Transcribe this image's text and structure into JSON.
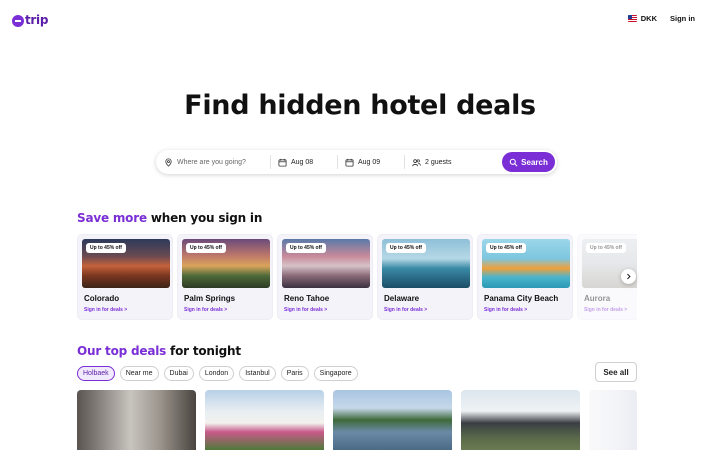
{
  "header": {
    "logo_text": "trip",
    "currency": "DKK",
    "sign_in": "Sign in",
    "flag_icon": "us-flag-icon"
  },
  "hero": {
    "title": "Find hidden hotel deals"
  },
  "search": {
    "destination_placeholder": "Where are you going?",
    "check_in": "Aug 08",
    "check_out": "Aug 09",
    "guests": "2 guests",
    "search_label": "Search",
    "accent_color": "#7a2ed6"
  },
  "deals_section": {
    "title_accent": "Save more",
    "title_rest": " when you sign in",
    "cards": [
      {
        "badge": "Up to 45% off",
        "name": "Colorado",
        "link": "Sign in for deals >"
      },
      {
        "badge": "Up to 45% off",
        "name": "Palm Springs",
        "link": "Sign in for deals >"
      },
      {
        "badge": "Up to 45% off",
        "name": "Reno Tahoe",
        "link": "Sign in for deals >"
      },
      {
        "badge": "Up to 45% off",
        "name": "Delaware",
        "link": "Sign in for deals >"
      },
      {
        "badge": "Up to 45% off",
        "name": "Panama City Beach",
        "link": "Sign in for deals >"
      },
      {
        "badge": "Up to 45% off",
        "name": "Aurora",
        "link": "Sign in for deals >"
      }
    ]
  },
  "top_deals_section": {
    "title_accent": "Our top deals",
    "title_rest": " for tonight",
    "chips": [
      "Holbaek",
      "Near me",
      "Dubai",
      "London",
      "Istanbul",
      "Paris",
      "Singapore"
    ],
    "active_chip": "Holbaek",
    "see_all": "See all"
  }
}
